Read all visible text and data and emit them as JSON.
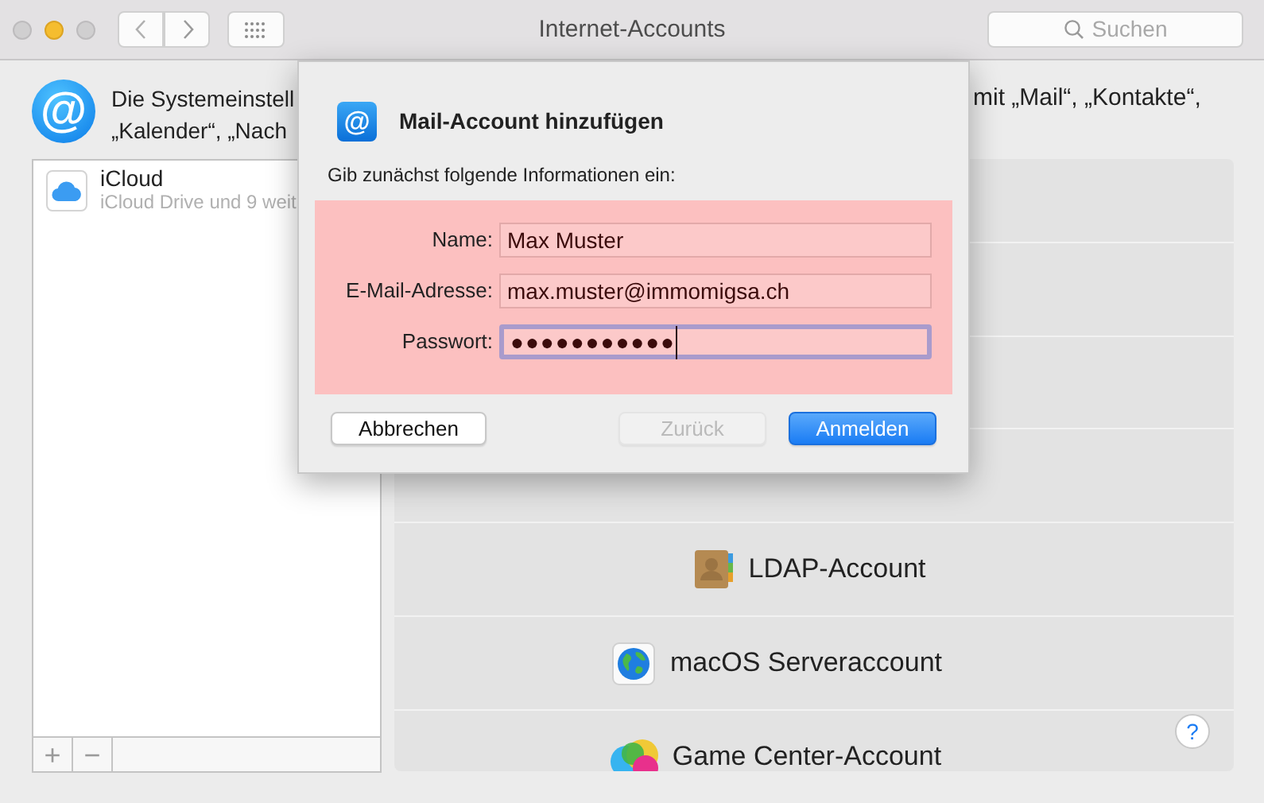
{
  "window": {
    "title": "Internet-Accounts",
    "search": {
      "placeholder": "Suchen"
    }
  },
  "intro": {
    "icon_glyph": "@",
    "left_lines": [
      "Die Systemeinstell",
      "„Kalender“, „Nach"
    ],
    "right_text": "mit „Mail“, „Kontakte“,"
  },
  "accounts": [
    {
      "name": "iCloud",
      "detail": "iCloud Drive und 9 weit",
      "selected": false
    }
  ],
  "list_buttons": [
    "+",
    "−"
  ],
  "account_types": [
    {
      "label": "LDAP-Account",
      "kind": "contacts"
    },
    {
      "label": "macOS Serveraccount",
      "kind": "server"
    },
    {
      "label": "Game Center-Account",
      "kind": "gamecenter"
    }
  ],
  "help": "?",
  "dialog": {
    "icon_glyph": "@",
    "title": "Mail-Account hinzufügen",
    "prompt": "Gib zunächst folgende Informationen ein:",
    "invalid": true,
    "fields": [
      {
        "label": "Name:",
        "value": "Max Muster",
        "focused": false
      },
      {
        "label": "E-Mail-Adresse:",
        "value": "max.muster@immomigsa.ch",
        "focused": false
      },
      {
        "label": "Passwort:",
        "value": "●●●●●●●●●●●",
        "focused": true
      }
    ],
    "buttons": [
      {
        "label": "Abbrechen",
        "kind": "cancel",
        "disabled": false
      },
      {
        "label": "Zurück",
        "kind": "back",
        "disabled": true
      },
      {
        "label": "Anmelden",
        "kind": "primary",
        "disabled": false
      }
    ]
  }
}
